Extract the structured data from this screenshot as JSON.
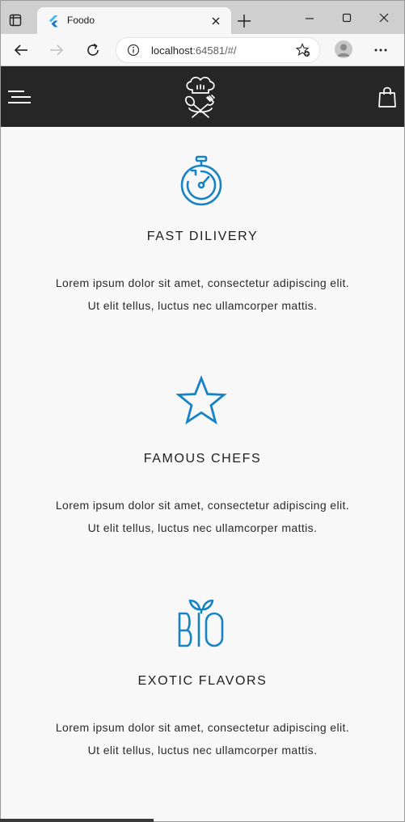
{
  "browser": {
    "tab_title": "Foodo",
    "url_host": "localhost",
    "url_rest": ":64581/#/"
  },
  "icons": {
    "tab_actions": "tab-actions-icon",
    "favicon": "flutter-icon",
    "tab_close": "close-icon",
    "new_tab": "plus-icon",
    "minimize": "minimize-icon",
    "maximize": "maximize-icon",
    "window_close": "close-icon",
    "back": "arrow-left-icon",
    "forward": "arrow-right-icon",
    "reload": "reload-icon",
    "site_info": "info-icon",
    "favorites": "star-plus-icon",
    "profile": "profile-icon",
    "menu": "more-icon",
    "hamburger": "hamburger-menu-icon",
    "logo": "chef-logo-icon",
    "cart": "shopping-bag-icon"
  },
  "colors": {
    "accent": "#1683c4",
    "header_bg": "#262626",
    "page_bg": "#f8f8f8"
  },
  "features": [
    {
      "icon": "stopwatch-icon",
      "title": "FAST DILIVERY",
      "line1": "Lorem ipsum dolor sit amet, consectetur adipiscing elit.",
      "line2": "Ut elit tellus, luctus nec ullamcorper mattis."
    },
    {
      "icon": "star-icon",
      "title": "FAMOUS CHEFS",
      "line1": "Lorem ipsum dolor sit amet, consectetur adipiscing elit.",
      "line2": "Ut elit tellus, luctus nec ullamcorper mattis."
    },
    {
      "icon": "bio-leaf-icon",
      "title": "EXOTIC FLAVORS",
      "line1": "Lorem ipsum dolor sit amet, consectetur adipiscing elit.",
      "line2": "Ut elit tellus, luctus nec ullamcorper mattis."
    }
  ]
}
